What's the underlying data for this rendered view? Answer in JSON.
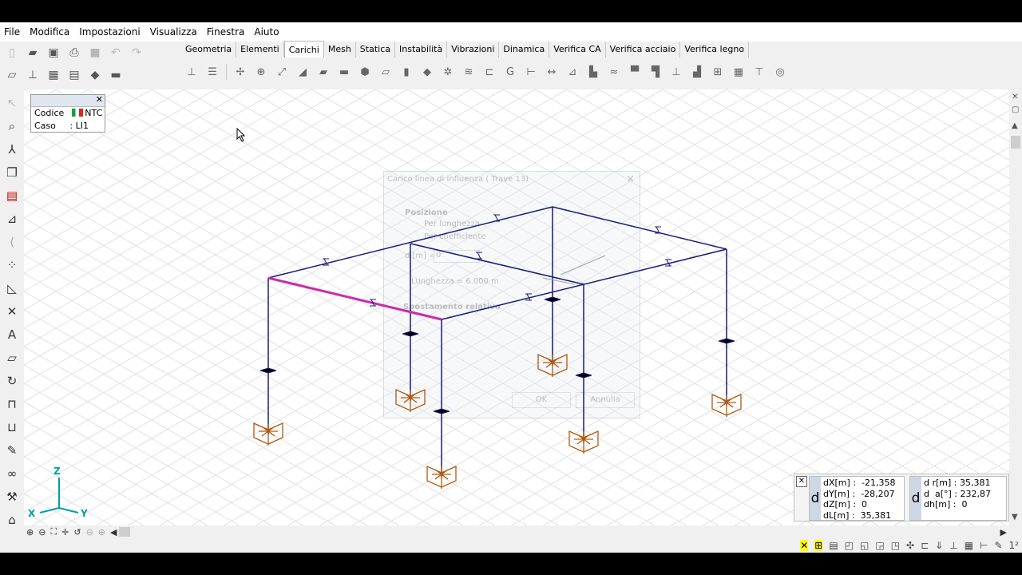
{
  "menu": [
    "File",
    "Modifica",
    "Impostazioni",
    "Visualizza",
    "Finestra",
    "Aiuto"
  ],
  "tabs": [
    "Geometria",
    "Elementi",
    "Carichi",
    "Mesh",
    "Statica",
    "Instabilità",
    "Vibrazioni",
    "Dinamica",
    "Verifica CA",
    "Verifica acciaio",
    "Verifica legno"
  ],
  "active_tab": "Carichi",
  "info_box": {
    "codice_label": "Codice",
    "codice_value": "NTC",
    "caso_label": "Caso",
    "caso_value": ": LI1"
  },
  "ghost_dialog": {
    "title": "Carico linea di influenza ( Trave 13)",
    "posizione": "Posizione",
    "per_lunghezza": "Per lunghezza",
    "per_coefficiente": "Per coefficiente",
    "d_label": "d [m] =",
    "d_value": "0",
    "lunghezza": "Lunghezza = 6.000 m",
    "spostamento": "Spostamento relativo",
    "ok": "OK",
    "annulla": "Annulla"
  },
  "axes": {
    "z": "Z",
    "x": "X",
    "y": "Y"
  },
  "coords": {
    "dX": "dX[m] :  -21,358",
    "dY": "dY[m] :  -28,207",
    "dZ": "dZ[m] :  0",
    "dL": "dL[m] :  35,381",
    "dr": "d r[m] : 35,381",
    "da": "d  a[°] : 232,87",
    "dh": "dh[m] :  0",
    "d_label": "d"
  },
  "status_scale": "1²",
  "colors": {
    "frame": "#1a1a7a",
    "selected_beam": "#cc2ca8",
    "support": "#b05a10",
    "grid": "#e4e4e4"
  }
}
